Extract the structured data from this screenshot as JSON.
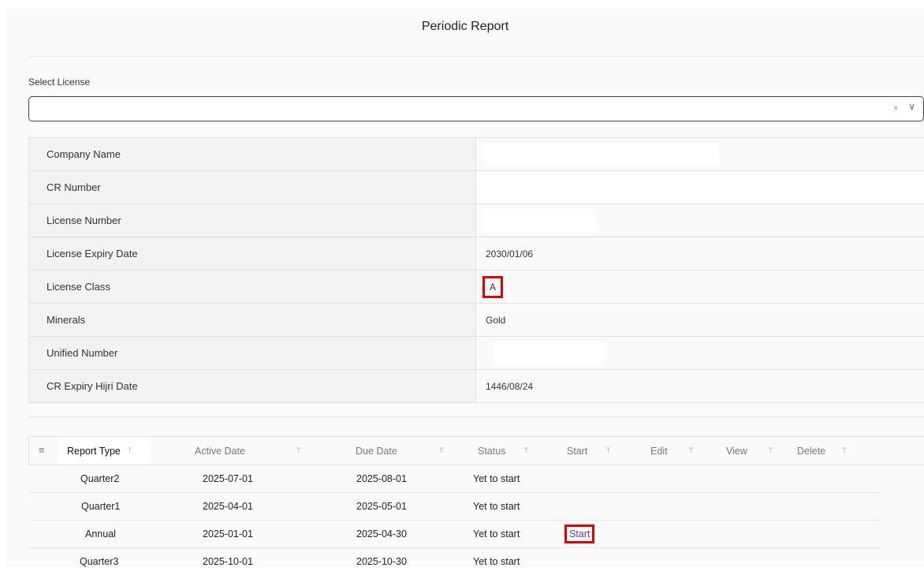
{
  "header": {
    "title": "Periodic Report"
  },
  "license_select": {
    "label": "Select License",
    "value": "",
    "clear_icon": "×",
    "chevron_icon": "∨"
  },
  "info": {
    "rows": [
      {
        "label": "Company Name",
        "value": ""
      },
      {
        "label": "CR Number",
        "value": ""
      },
      {
        "label": "License Number",
        "value": ""
      },
      {
        "label": "License Expiry Date",
        "value": "2030/01/06"
      },
      {
        "label": "License Class",
        "value": "A"
      },
      {
        "label": "Minerals",
        "value": "Gold"
      },
      {
        "label": "Unified Number",
        "value": ""
      },
      {
        "label": "CR Expiry Hijri Date",
        "value": "1446/08/24"
      }
    ]
  },
  "grid": {
    "columns": [
      "Report Type",
      "Active Date",
      "Due Date",
      "Status",
      "Start",
      "Edit",
      "View",
      "Delete"
    ],
    "filter_icon": "⊤",
    "menu_icon": "≡",
    "rows": [
      {
        "report_type": "Quarter2",
        "active_date": "2025-07-01",
        "due_date": "2025-08-01",
        "status": "Yet to start",
        "start": ""
      },
      {
        "report_type": "Quarter1",
        "active_date": "2025-04-01",
        "due_date": "2025-05-01",
        "status": "Yet to start",
        "start": ""
      },
      {
        "report_type": "Annual",
        "active_date": "2025-01-01",
        "due_date": "2025-04-30",
        "status": "Yet to start",
        "start": "Start"
      },
      {
        "report_type": "Quarter3",
        "active_date": "2025-10-01",
        "due_date": "2025-10-30",
        "status": "Yet to start",
        "start": ""
      }
    ]
  },
  "colors": {
    "highlight": "#e00000",
    "link": "#4a3fcf"
  }
}
